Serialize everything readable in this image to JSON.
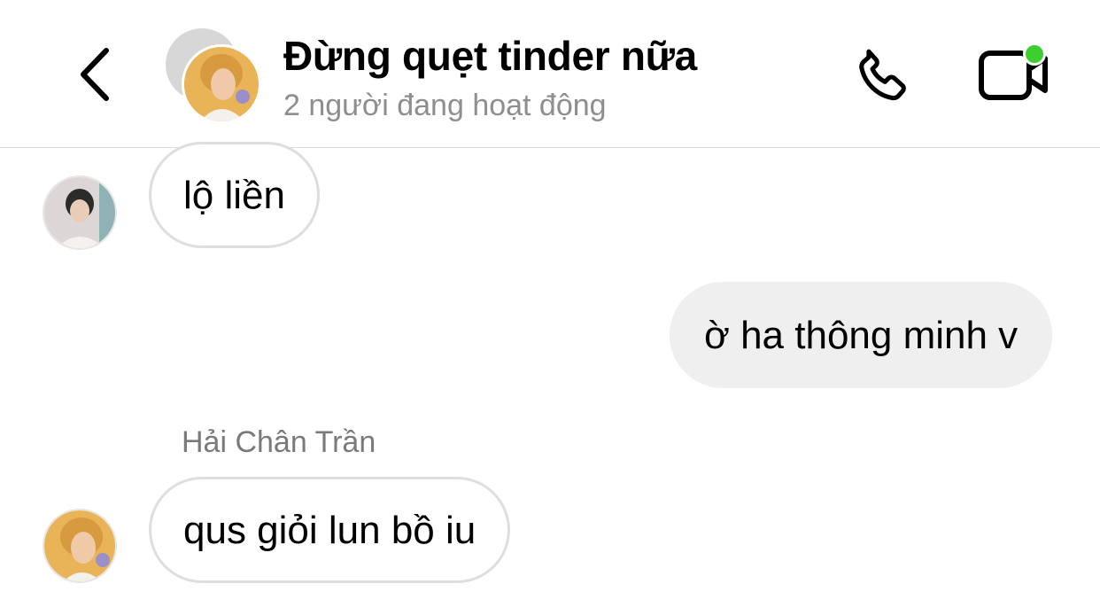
{
  "header": {
    "title": "Đừng quẹt tinder nữa",
    "subtitle": "2 người đang hoạt động",
    "online_color": "#3ccf2f"
  },
  "icons": {
    "back": "chevron-left-icon",
    "call": "phone-icon",
    "video": "video-camera-icon"
  },
  "messages": [
    {
      "direction": "incoming",
      "text": "lộ liền"
    },
    {
      "direction": "outgoing",
      "text": "ờ ha thông minh v"
    },
    {
      "direction": "incoming",
      "sender": "Hải Chân Trần",
      "text": "qus giỏi lun bồ iu"
    }
  ]
}
